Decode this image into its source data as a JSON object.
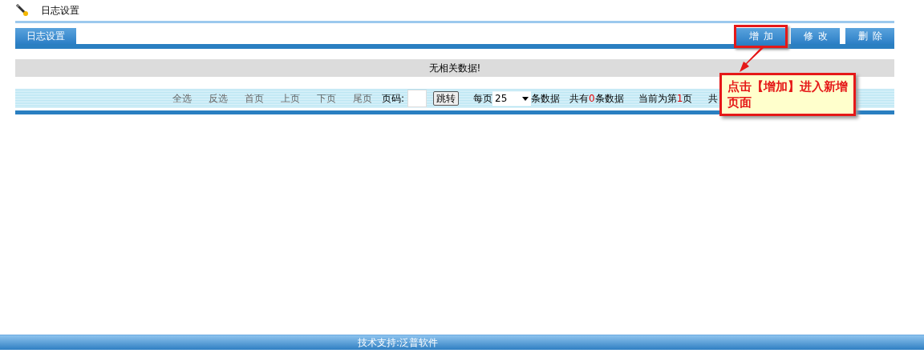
{
  "page_title": "日志设置",
  "toolbar": {
    "tab": "日志设置",
    "buttons": [
      {
        "label": "增加",
        "highlighted": true
      },
      {
        "label": "修改",
        "highlighted": false
      },
      {
        "label": "删除",
        "highlighted": false
      }
    ]
  },
  "empty_message": "无相关数据!",
  "pager": {
    "links": [
      "全选",
      "反选",
      "首页",
      "上页",
      "下页",
      "尾页"
    ],
    "page_label": "页码:",
    "jump_button": "跳转",
    "per_page_label": "每页",
    "per_page_value": "25",
    "per_page_suffix": "条数据",
    "total": {
      "before": "共有",
      "number": "0",
      "after": "条数据"
    },
    "current": {
      "before": "当前为第",
      "number": "1",
      "after": "页"
    },
    "cut_text": "共"
  },
  "callout": {
    "text": "点击【增加】进入新增页面"
  },
  "footer": "技术支持:泛普软件"
}
